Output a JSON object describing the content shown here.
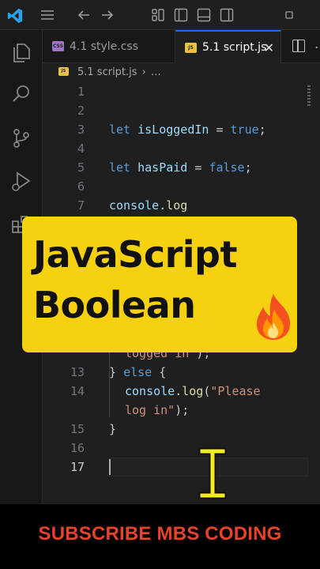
{
  "tabs": [
    {
      "label": "4.1 style.css",
      "badge": "CSS"
    },
    {
      "label": "5.1 script.js",
      "badge": "JS"
    }
  ],
  "tab_close_glyph": "✕",
  "more_actions_glyph": "⋯",
  "breadcrumb": {
    "file": "5.1 script.js",
    "separator": "›",
    "more": "…",
    "badge": "JS"
  },
  "editor": {
    "line_numbers": [
      "1",
      "2",
      "3",
      "4",
      "5",
      "6",
      "7",
      "13",
      "14",
      "15",
      "16",
      "17"
    ],
    "active_line": "17",
    "code": {
      "l3": {
        "kw": "let",
        "var": "isLoggedIn",
        "op": " = ",
        "val": "true",
        "end": ";"
      },
      "l5": {
        "kw": "let",
        "var": "hasPaid",
        "op": " = ",
        "val": "false",
        "end": ";"
      },
      "l7": {
        "obj": "console",
        "dot": ".",
        "fn": "log"
      },
      "l12_tail": {
        "str": "logged in\"",
        "end": ");"
      },
      "l13": {
        "brace": "}",
        "kw": "else",
        "open": "{"
      },
      "l14": {
        "obj": "console",
        "dot": ".",
        "fn": "log",
        "paren": "(",
        "str": "\"Please"
      },
      "l14_wrap": {
        "str": "log in\"",
        "end": ");"
      },
      "l15": {
        "brace": "}"
      }
    }
  },
  "banner": {
    "line1": "JavaScript",
    "line2": "Boolean",
    "emoji": "fire-icon"
  },
  "footer": {
    "text": "SUBSCRIBE MBS CODING"
  },
  "colors": {
    "banner": "#f5d10f",
    "footer_text": "#e8432a",
    "keyword": "#569cd6",
    "variable": "#9cdcfe",
    "string": "#ce9178",
    "function": "#dcdcaa"
  }
}
